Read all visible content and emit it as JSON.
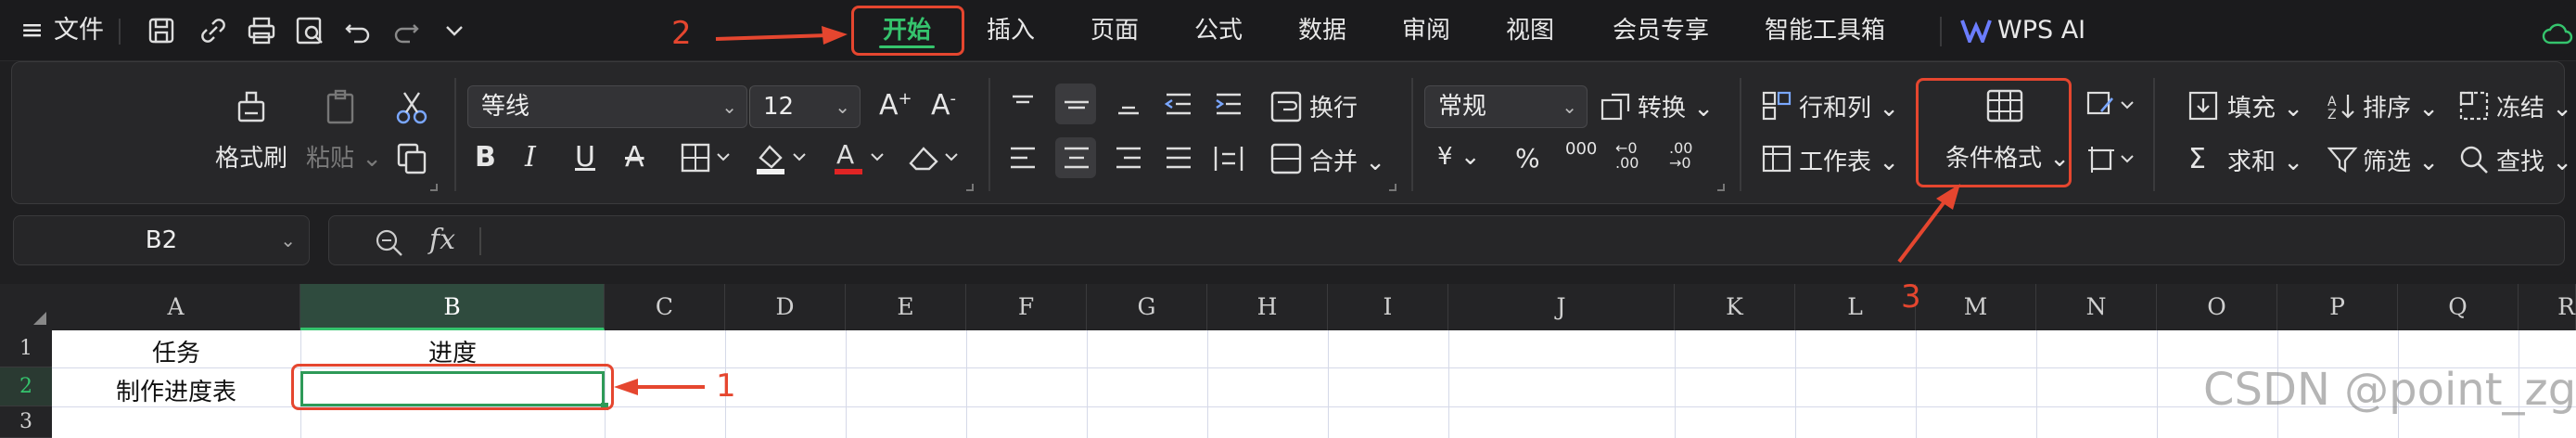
{
  "menubar": {
    "hamburger_label": "≡",
    "file_label": "文件",
    "tabs": [
      {
        "label": "开始",
        "active": true
      },
      {
        "label": "插入"
      },
      {
        "label": "页面"
      },
      {
        "label": "公式"
      },
      {
        "label": "数据"
      },
      {
        "label": "审阅"
      },
      {
        "label": "视图"
      },
      {
        "label": "会员专享"
      },
      {
        "label": "智能工具箱"
      }
    ],
    "wps_ai_label": "WPS AI",
    "quick_icons": [
      "save-icon",
      "share-icon",
      "print-icon",
      "print-preview-icon",
      "undo-icon",
      "redo-icon",
      "chevron-down-icon"
    ]
  },
  "ribbon": {
    "format_painter": "格式刷",
    "paste": "粘贴",
    "font_name": "等线",
    "font_size": "12",
    "wrap_text": "换行",
    "merge": "合并",
    "number_format": "常规",
    "convert": "转换",
    "rows_cols": "行和列",
    "worksheet": "工作表",
    "conditional_format": "条件格式",
    "fill": "填充",
    "sort": "排序",
    "freeze": "冻结",
    "sum": "求和",
    "filter": "筛选",
    "find": "查找",
    "currency_symbol": "¥",
    "percent_symbol": "%",
    "thousands_symbol": "000"
  },
  "formula_bar": {
    "name_box": "B2",
    "fx": "fx",
    "formula": ""
  },
  "sheet": {
    "columns": [
      "A",
      "B",
      "C",
      "D",
      "E",
      "F",
      "G",
      "H",
      "I",
      "J",
      "K",
      "L",
      "M",
      "N",
      "O",
      "P",
      "Q",
      "R"
    ],
    "selected_column": "B",
    "rows": [
      "1",
      "2",
      "3"
    ],
    "selected_row": "2",
    "cells": {
      "A1": "任务",
      "B1": "进度",
      "A2": "制作进度表",
      "B2": ""
    }
  },
  "annotations": {
    "step1": "1",
    "step2": "2",
    "step3": "3",
    "color": "#e5462f"
  },
  "watermark": "CSDN @point_zg",
  "colors": {
    "accent": "#35c46d",
    "annotation": "#e5462f",
    "background": "#1f1f21"
  }
}
